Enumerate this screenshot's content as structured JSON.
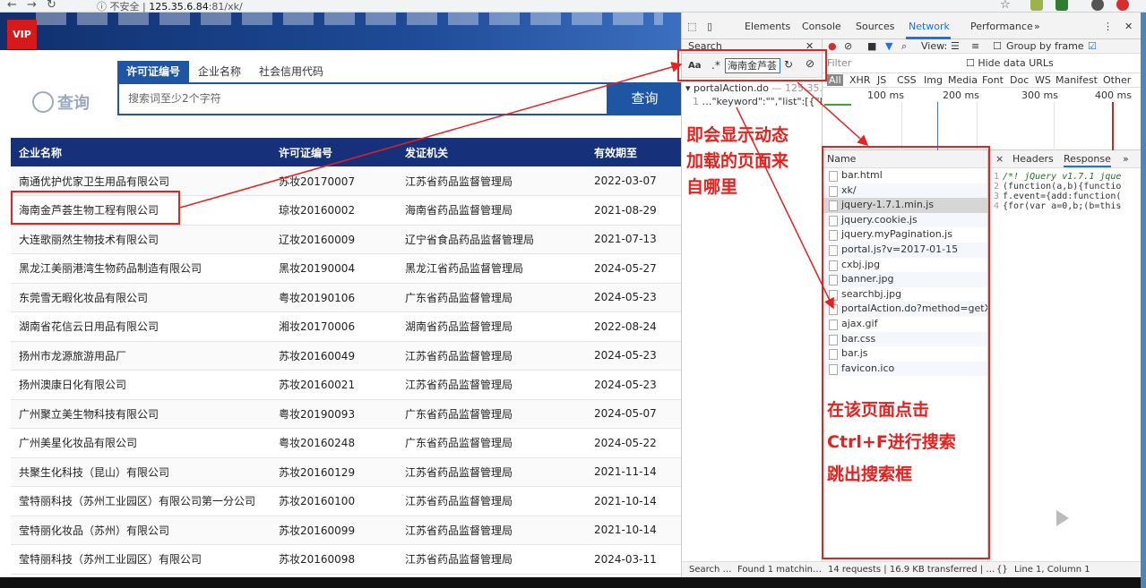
{
  "browser": {
    "security_label": "不安全",
    "url_host": "125.35.6.84",
    "url_path": ":81/xk/"
  },
  "site": {
    "vip_badge": "VIP",
    "search_tabs": [
      "许可证编号",
      "企业名称",
      "社会信用代码"
    ],
    "search_logo_text": "查询",
    "search_placeholder": "搜索词至少2个字符",
    "search_button": "查询"
  },
  "table": {
    "headers": [
      "企业名称",
      "许可证编号",
      "发证机关",
      "有效期至"
    ],
    "rows": [
      [
        "南通优护优家卫生用品有限公司",
        "苏妆20170007",
        "江苏省药品监督管理局",
        "2022-03-07"
      ],
      [
        "海南金芦荟生物工程有限公司",
        "琼妆20160002",
        "海南省药品监督管理局",
        "2021-08-29"
      ],
      [
        "大连歌丽然生物技术有限公司",
        "辽妆20160009",
        "辽宁省食品药品监督管理局",
        "2021-07-13"
      ],
      [
        "黑龙江美丽港湾生物药品制造有限公司",
        "黑妆20190004",
        "黑龙江省药品监督管理局",
        "2024-05-27"
      ],
      [
        "东莞雪无暇化妆品有限公司",
        "粤妆20190106",
        "广东省药品监督管理局",
        "2024-05-23"
      ],
      [
        "湖南省花信云日用品有限公司",
        "湘妆20170006",
        "湖南省药品监督管理局",
        "2022-08-24"
      ],
      [
        "扬州市龙源旅游用品厂",
        "苏妆20160049",
        "江苏省药品监督管理局",
        "2024-05-23"
      ],
      [
        "扬州澳康日化有限公司",
        "苏妆20160021",
        "江苏省药品监督管理局",
        "2024-05-23"
      ],
      [
        "广州聚立美生物科技有限公司",
        "粤妆20190093",
        "广东省药品监督管理局",
        "2024-05-07"
      ],
      [
        "广州美星化妆品有限公司",
        "粤妆20160248",
        "广东省药品监督管理局",
        "2024-05-22"
      ],
      [
        "共聚生化科技（昆山）有限公司",
        "苏妆20160129",
        "江苏省药品监督管理局",
        "2021-11-14"
      ],
      [
        "莹特丽科技（苏州工业园区）有限公司第一分公司",
        "苏妆20160100",
        "江苏省药品监督管理局",
        "2021-10-14"
      ],
      [
        "莹特丽化妆品（苏州）有限公司",
        "苏妆20160099",
        "江苏省药品监督管理局",
        "2021-10-14"
      ],
      [
        "莹特丽科技（苏州工业园区）有限公司",
        "苏妆20160098",
        "江苏省药品监督管理局",
        "2024-03-11"
      ]
    ]
  },
  "devtools": {
    "tabs": [
      "Elements",
      "Console",
      "Sources",
      "Network",
      "Performance",
      "»"
    ],
    "active_tab": "Network",
    "search": {
      "title": "Search",
      "aa": "Aa",
      "regex": ".*",
      "query": "海南金芦荟",
      "result_file": "▾ portalAction.do",
      "result_host": "— 125.35.6…",
      "result_line_no": "1",
      "result_line": "…\"keyword\":\"\",\"list\":[{\"ID…",
      "footer_left": "Search …",
      "footer_right": "Found 1 matchin…"
    },
    "network": {
      "view_label": "View:",
      "group_by_frame": "Group by frame",
      "filter_placeholder": "Filter",
      "hide_data_urls": "Hide data URLs",
      "types": [
        "All",
        "XHR",
        "JS",
        "CSS",
        "Img",
        "Media",
        "Font",
        "Doc",
        "WS",
        "Manifest",
        "Other"
      ],
      "timeline_ticks": [
        "100 ms",
        "200 ms",
        "300 ms",
        "400 ms"
      ],
      "name_header": "Name",
      "requests": [
        "bar.html",
        "xk/",
        "jquery-1.7.1.min.js",
        "jquery.cookie.js",
        "jquery.myPagination.js",
        "portal.js?v=2017-01-15",
        "cxbj.jpg",
        "banner.jpg",
        "searchbj.jpg",
        "portalAction.do?method=getX…",
        "ajax.gif",
        "bar.css",
        "bar.js",
        "favicon.ico"
      ],
      "detail_tabs": [
        "×",
        "Headers",
        "Response",
        "»"
      ],
      "code_lines": [
        [
          "1",
          "/*! jQuery v1.7.1 jque"
        ],
        [
          "2",
          "(function(a,b){functio"
        ],
        [
          "3",
          "f.event={add:function("
        ],
        [
          "4",
          "{for(var a=0,b;(b=this"
        ]
      ],
      "status": "14 requests | 16.9 KB transferred | …",
      "cursor_pos": "Line 1, Column 1",
      "braces": "{}"
    }
  },
  "annotations": {
    "dynamic_source": [
      "即会显示动态",
      "加载的页面来",
      "自哪里"
    ],
    "ctrl_f_hint": [
      "在该页面点击",
      "Ctrl+F进行搜索",
      "跳出搜索框"
    ]
  }
}
